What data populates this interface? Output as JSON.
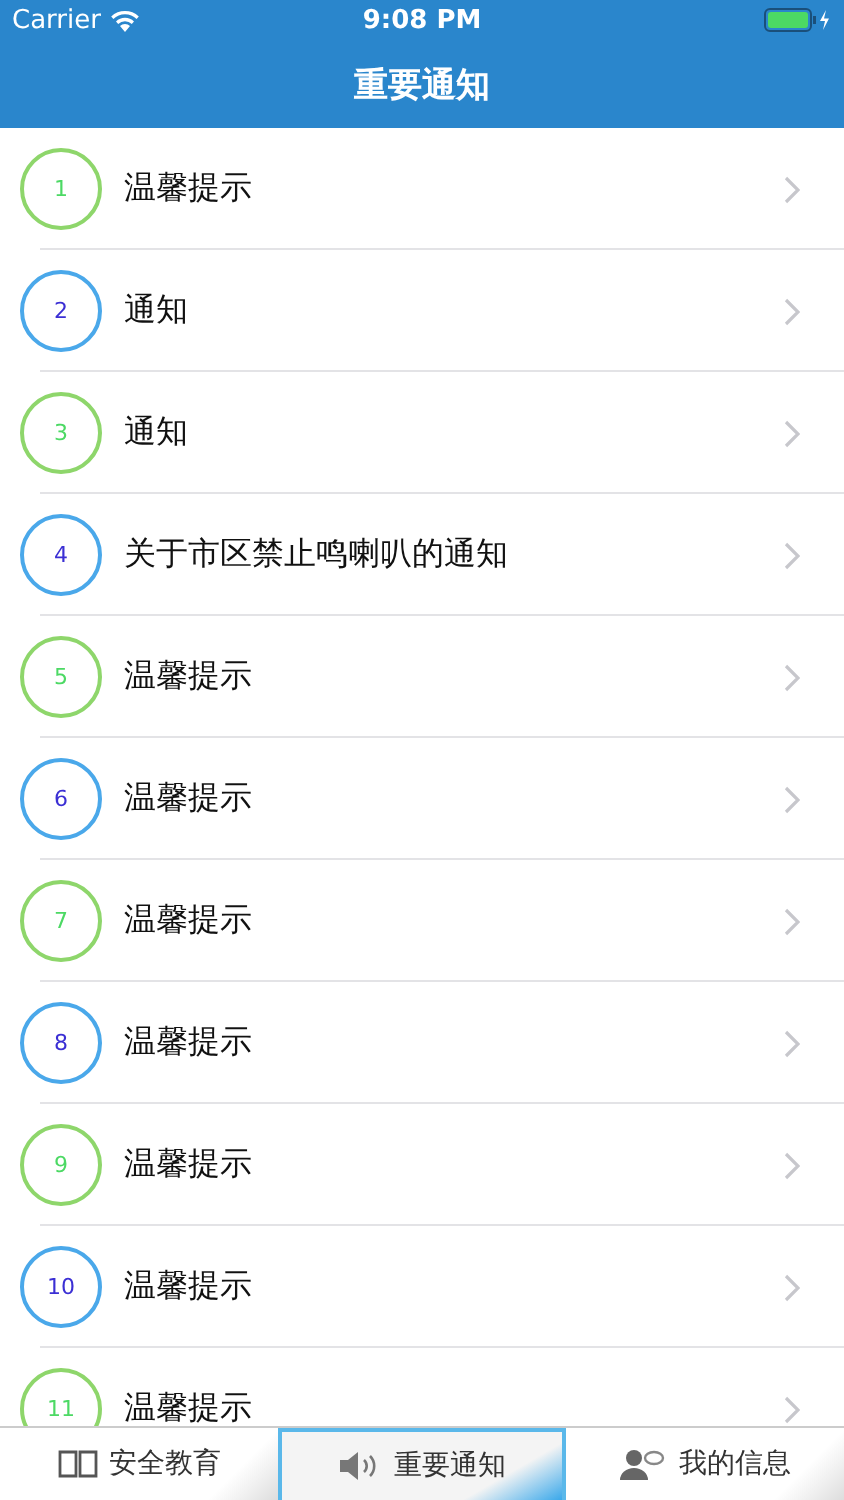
{
  "status_bar": {
    "carrier": "Carrier",
    "time": "9:08 PM"
  },
  "nav_bar": {
    "title": "重要通知"
  },
  "items": [
    {
      "number": "1",
      "title": "温馨提示",
      "color": "#8ed66b"
    },
    {
      "number": "2",
      "title": "通知",
      "color": "#4aa8ea"
    },
    {
      "number": "3",
      "title": "通知",
      "color": "#8ed66b"
    },
    {
      "number": "4",
      "title": "关于市区禁止鸣喇叭的通知",
      "color": "#4aa8ea"
    },
    {
      "number": "5",
      "title": "温馨提示",
      "color": "#8ed66b"
    },
    {
      "number": "6",
      "title": "温馨提示",
      "color": "#4aa8ea"
    },
    {
      "number": "7",
      "title": "温馨提示",
      "color": "#8ed66b"
    },
    {
      "number": "8",
      "title": "温馨提示",
      "color": "#4aa8ea"
    },
    {
      "number": "9",
      "title": "温馨提示",
      "color": "#8ed66b"
    },
    {
      "number": "10",
      "title": "温馨提示",
      "color": "#4aa8ea"
    },
    {
      "number": "11",
      "title": "温馨提示",
      "color": "#8ed66b"
    }
  ],
  "tabs": [
    {
      "label": "安全教育",
      "kind": "book",
      "selected": false
    },
    {
      "label": "重要通知",
      "kind": "speaker",
      "selected": true
    },
    {
      "label": "我的信息",
      "kind": "person",
      "selected": false
    }
  ]
}
